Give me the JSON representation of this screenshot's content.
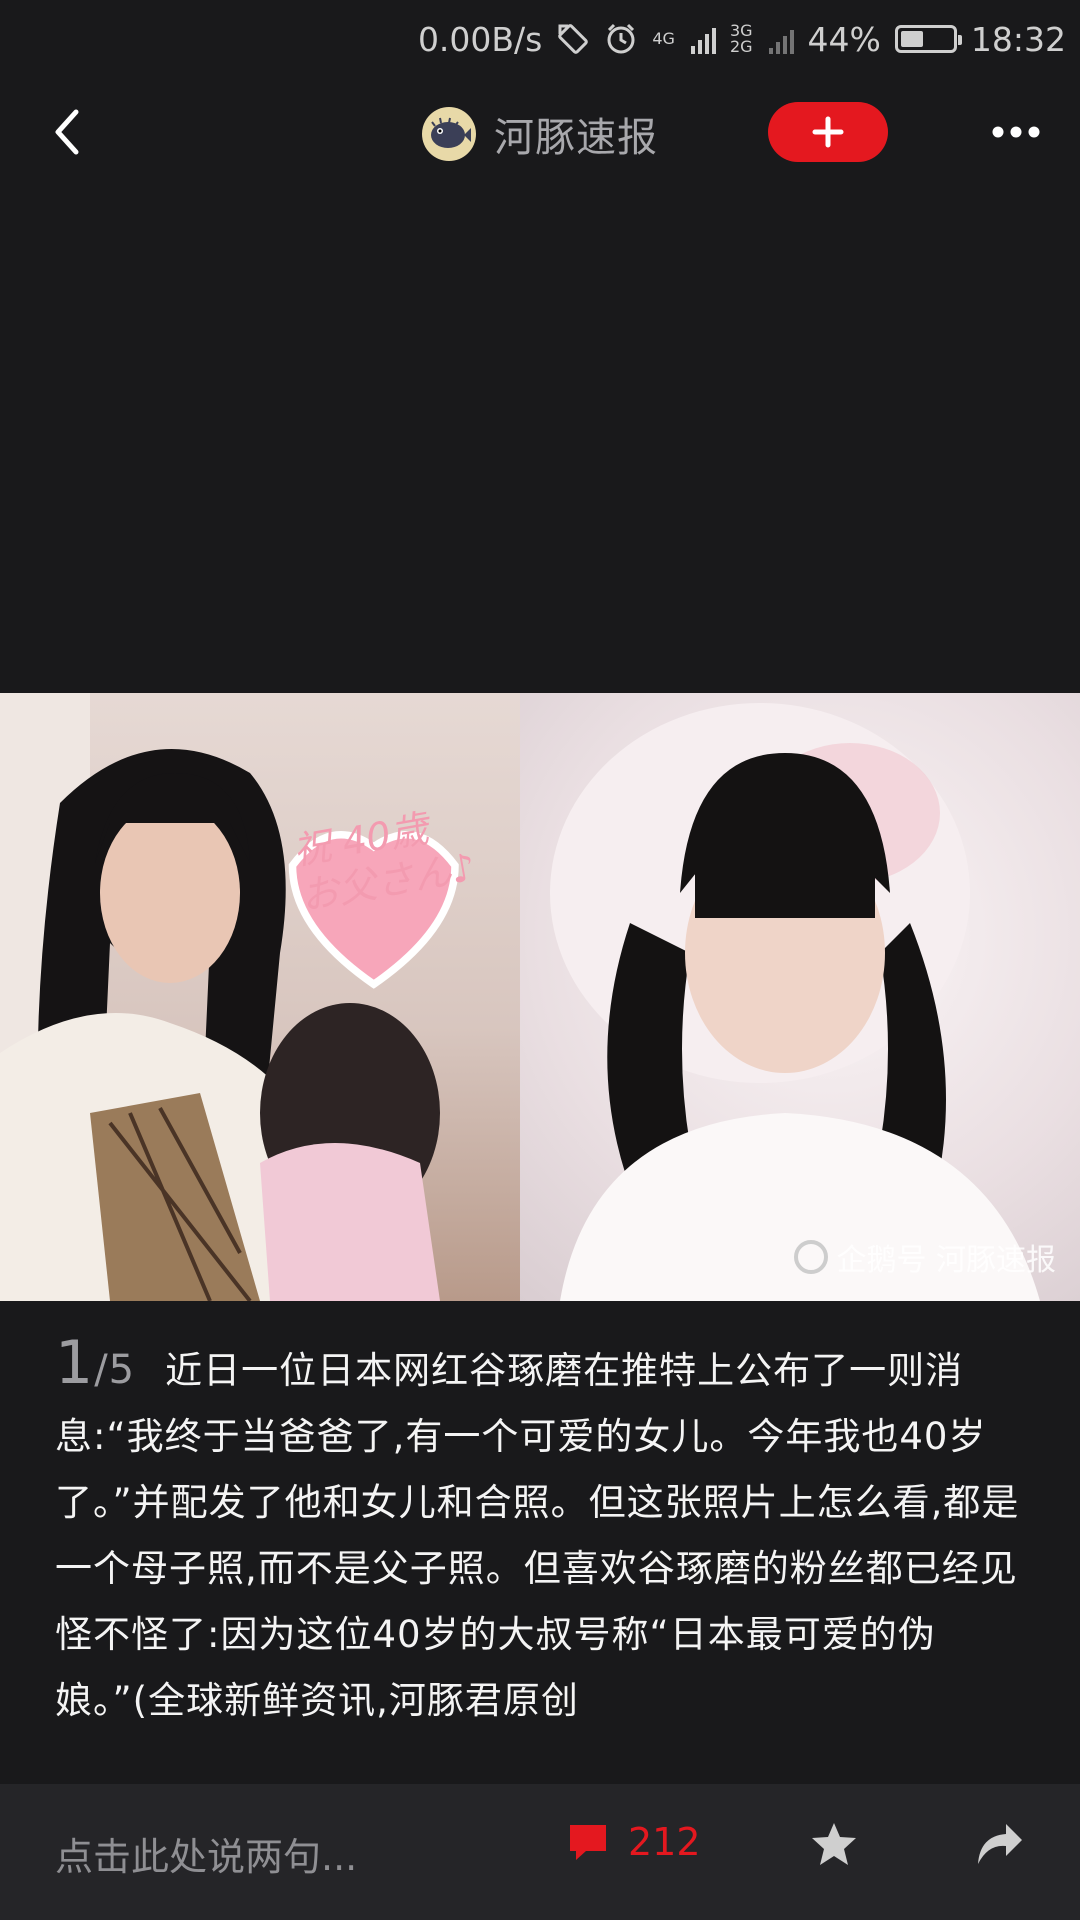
{
  "status_bar": {
    "net_speed": "0.00B/s",
    "sim1": "4G",
    "sim2_top": "3G",
    "sim2_bottom": "2G",
    "battery": "44%",
    "battery_level": 0.44,
    "time": "18:32"
  },
  "header": {
    "channel_name": "河豚速报",
    "back_icon": "chevron-left-icon",
    "follow_icon": "plus-icon",
    "more_icon": "more-horizontal-icon",
    "accent_color": "#e4181f"
  },
  "photo": {
    "overlay_text_line1": "祝 40歳",
    "overlay_text_line2": "お父さん♪",
    "watermark": "企鹅号 河豚速报"
  },
  "article": {
    "page_current": "1",
    "page_total": "/5",
    "text": "近日一位日本网红谷琢磨在推特上公布了一则消息:“我终于当爸爸了,有一个可爱的女儿。今年我也40岁了。”并配发了他和女儿和合照。但这张照片上怎么看,都是一个母子照,而不是父子照。但喜欢谷琢磨的粉丝都已经见怪不怪了:因为这位40岁的大叔号称“日本最可爱的伪娘。”(全球新鲜资讯,河豚君原创"
  },
  "bottom_bar": {
    "comment_placeholder": "点击此处说两句...",
    "comment_count": "212",
    "comment_icon": "comment-icon",
    "favorite_icon": "star-icon",
    "share_icon": "share-icon"
  }
}
